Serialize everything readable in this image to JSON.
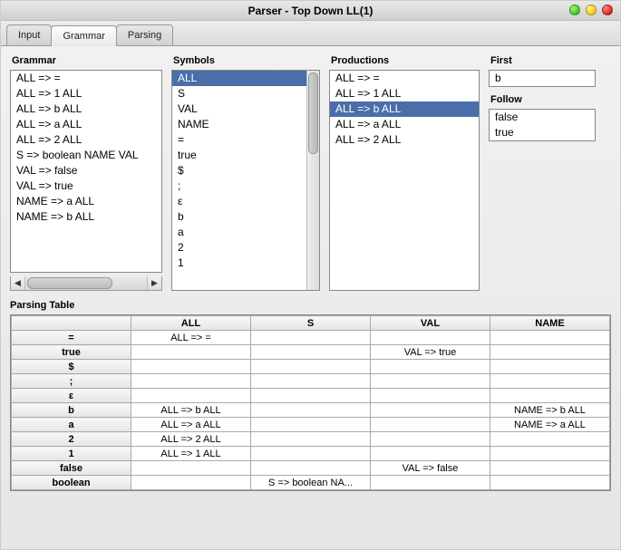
{
  "window": {
    "title": "Parser - Top Down LL(1)"
  },
  "tabs": {
    "items": [
      "Input",
      "Grammar",
      "Parsing"
    ],
    "active": 1
  },
  "panels": {
    "grammar_title": "Grammar",
    "symbols_title": "Symbols",
    "productions_title": "Productions",
    "first_title": "First",
    "follow_title": "Follow"
  },
  "grammar_items": [
    "ALL => =",
    "ALL => 1 ALL",
    "ALL => b ALL",
    "ALL => a ALL",
    "ALL => 2 ALL",
    "S => boolean NAME VAL",
    "VAL => false",
    "VAL => true",
    "NAME => a ALL",
    "NAME => b ALL"
  ],
  "symbols_items": [
    "ALL",
    "S",
    "VAL",
    "NAME",
    "=",
    "true",
    "$",
    ";",
    "ε",
    "b",
    "a",
    "2",
    "1"
  ],
  "symbols_selected": 0,
  "productions_items": [
    "ALL => =",
    "ALL => 1 ALL",
    "ALL => b ALL",
    "ALL => a ALL",
    "ALL => 2 ALL"
  ],
  "productions_selected": 2,
  "first_items": [
    "b"
  ],
  "follow_items": [
    "false",
    "true"
  ],
  "parsing_table": {
    "title": "Parsing Table",
    "columns": [
      "ALL",
      "S",
      "VAL",
      "NAME"
    ],
    "rows": [
      {
        "label": "=",
        "cells": [
          "ALL => =",
          "",
          "",
          ""
        ]
      },
      {
        "label": "true",
        "cells": [
          "",
          "",
          "VAL => true",
          ""
        ]
      },
      {
        "label": "$",
        "cells": [
          "",
          "",
          "",
          ""
        ]
      },
      {
        "label": ";",
        "cells": [
          "",
          "",
          "",
          ""
        ]
      },
      {
        "label": "ε",
        "cells": [
          "",
          "",
          "",
          ""
        ]
      },
      {
        "label": "b",
        "cells": [
          "ALL => b ALL",
          "",
          "",
          "NAME => b ALL"
        ]
      },
      {
        "label": "a",
        "cells": [
          "ALL => a ALL",
          "",
          "",
          "NAME => a ALL"
        ]
      },
      {
        "label": "2",
        "cells": [
          "ALL => 2 ALL",
          "",
          "",
          ""
        ]
      },
      {
        "label": "1",
        "cells": [
          "ALL => 1 ALL",
          "",
          "",
          ""
        ]
      },
      {
        "label": "false",
        "cells": [
          "",
          "",
          "VAL => false",
          ""
        ]
      },
      {
        "label": "boolean",
        "cells": [
          "",
          "S => boolean NA...",
          "",
          ""
        ]
      }
    ]
  }
}
